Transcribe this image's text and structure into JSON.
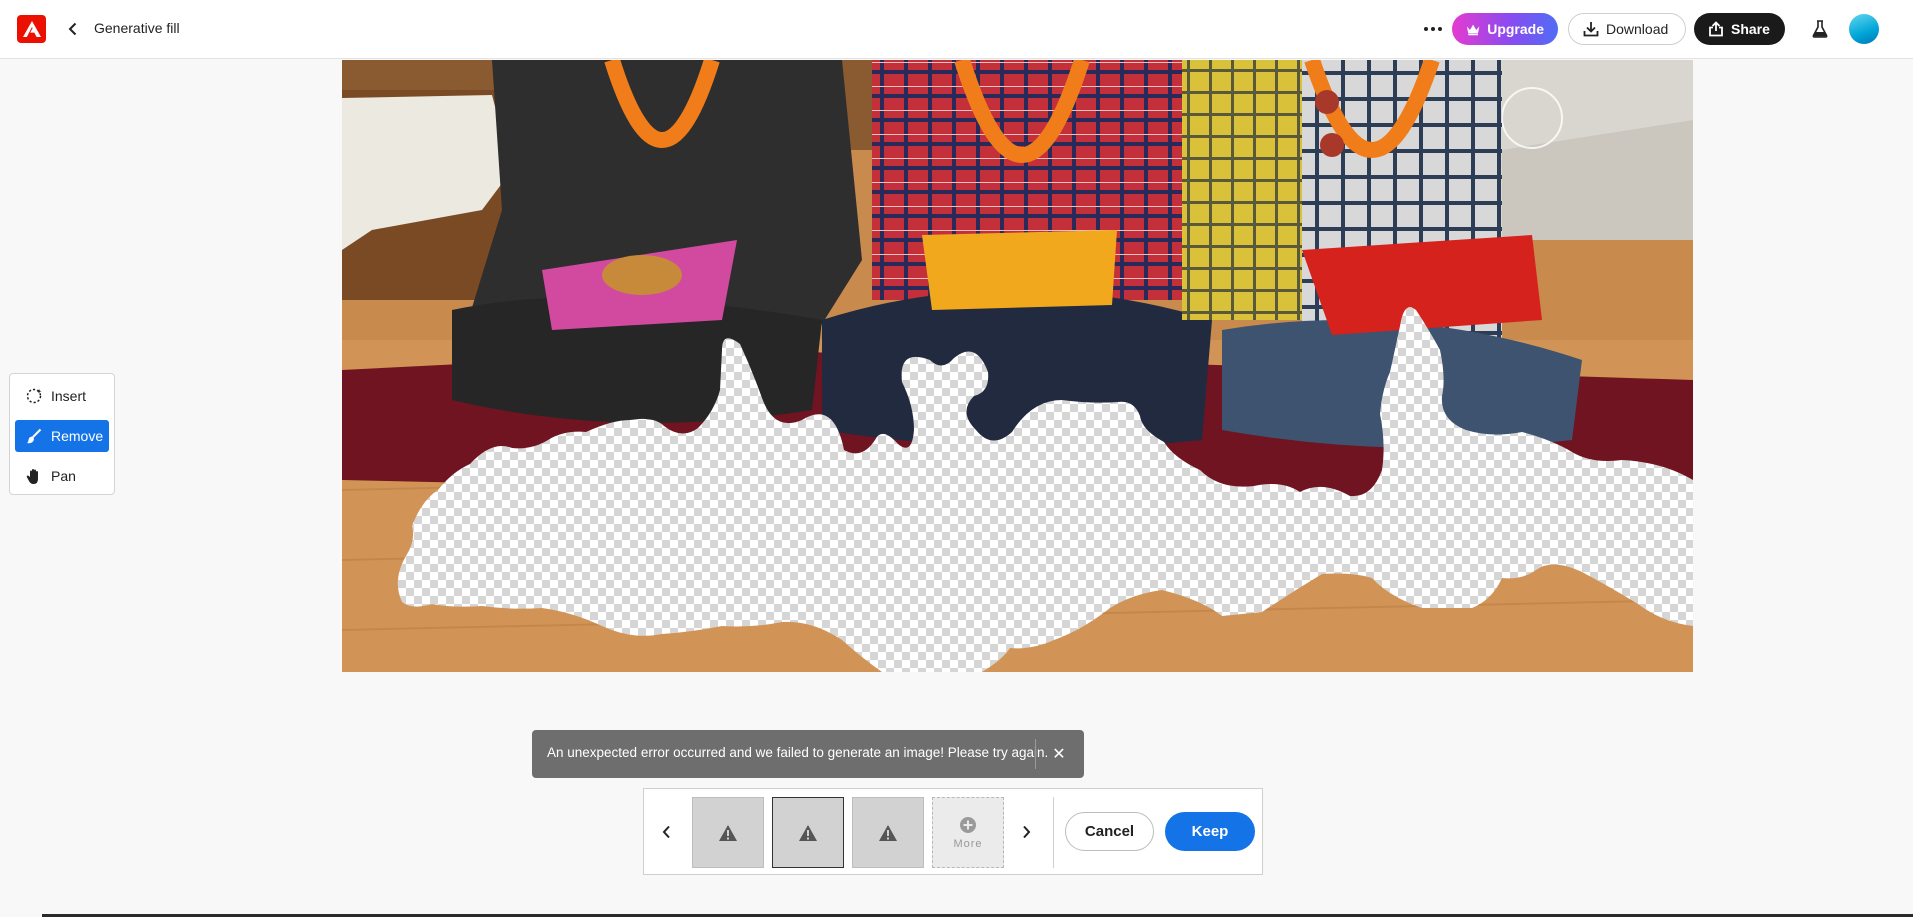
{
  "header": {
    "title": "Generative fill",
    "upgrade_label": "Upgrade",
    "download_label": "Download",
    "share_label": "Share"
  },
  "tools": [
    {
      "label": "Insert",
      "active": false
    },
    {
      "label": "Remove",
      "active": true
    },
    {
      "label": "Pan",
      "active": false
    }
  ],
  "toast": {
    "message": "An unexpected error occurred and we failed to generate an image! Please try again.",
    "close_symbol": "✕"
  },
  "variations": {
    "more_label": "More",
    "cancel_label": "Cancel",
    "keep_label": "Keep",
    "selected_index": 1
  },
  "colors": {
    "accent": "#1473e6",
    "logo": "#eb1000",
    "toast_bg": "#6e6e6e"
  }
}
